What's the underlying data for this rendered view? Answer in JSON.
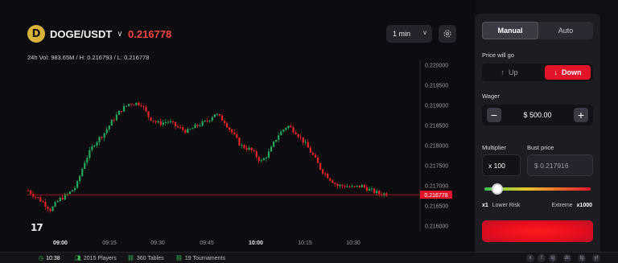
{
  "header": {
    "coin_badge": "D",
    "pair": "DOGE/USDT",
    "price": "0.216778",
    "price_arrow": "↓",
    "interval": "1 min",
    "stats": "24h Vol: 983.65M / H: 0.216793 / L: 0.216778"
  },
  "chart_data": {
    "type": "candlestick",
    "y_ticks": [
      "0.220000",
      "0.219500",
      "0.219000",
      "0.218500",
      "0.218000",
      "0.217500",
      "0.217000",
      "0.216500",
      "0.216000"
    ],
    "x_ticks": [
      "09:00",
      "09:15",
      "09:30",
      "09:45",
      "10:00",
      "10:15",
      "10:30"
    ],
    "current_price_label": "0.216778",
    "ylim": [
      0.216,
      0.22
    ],
    "colors": {
      "up": "#26a65b",
      "down": "#e3242b",
      "price_line": "#c2161f"
    }
  },
  "tradingview_logo": "17",
  "panel": {
    "tabs": [
      {
        "label": "Manual",
        "active": true
      },
      {
        "label": "Auto",
        "active": false
      }
    ],
    "direction_label": "Price will go",
    "up_label": "Up",
    "down_label": "Down",
    "wager_label": "Wager",
    "wager_value": "$ 500.00",
    "minus": "−",
    "plus": "+",
    "multiplier_label": "Multiplier",
    "multiplier_value": "x 100",
    "bust_label": "Bust price",
    "bust_value": "$ 0.217916",
    "risk_left_mult": "x1",
    "risk_left_text": "Lower Risk",
    "risk_right_text": "Extreme",
    "risk_right_mult": "x1000",
    "risk_slider_value": 0.1
  },
  "bottom_bar": {
    "time": "10:38",
    "players": "2015 Players",
    "tables": "360 Tables",
    "tournaments": "19 Tournaments",
    "socials": [
      "x",
      "f",
      "ig",
      "dc",
      "tg",
      "yt"
    ]
  }
}
